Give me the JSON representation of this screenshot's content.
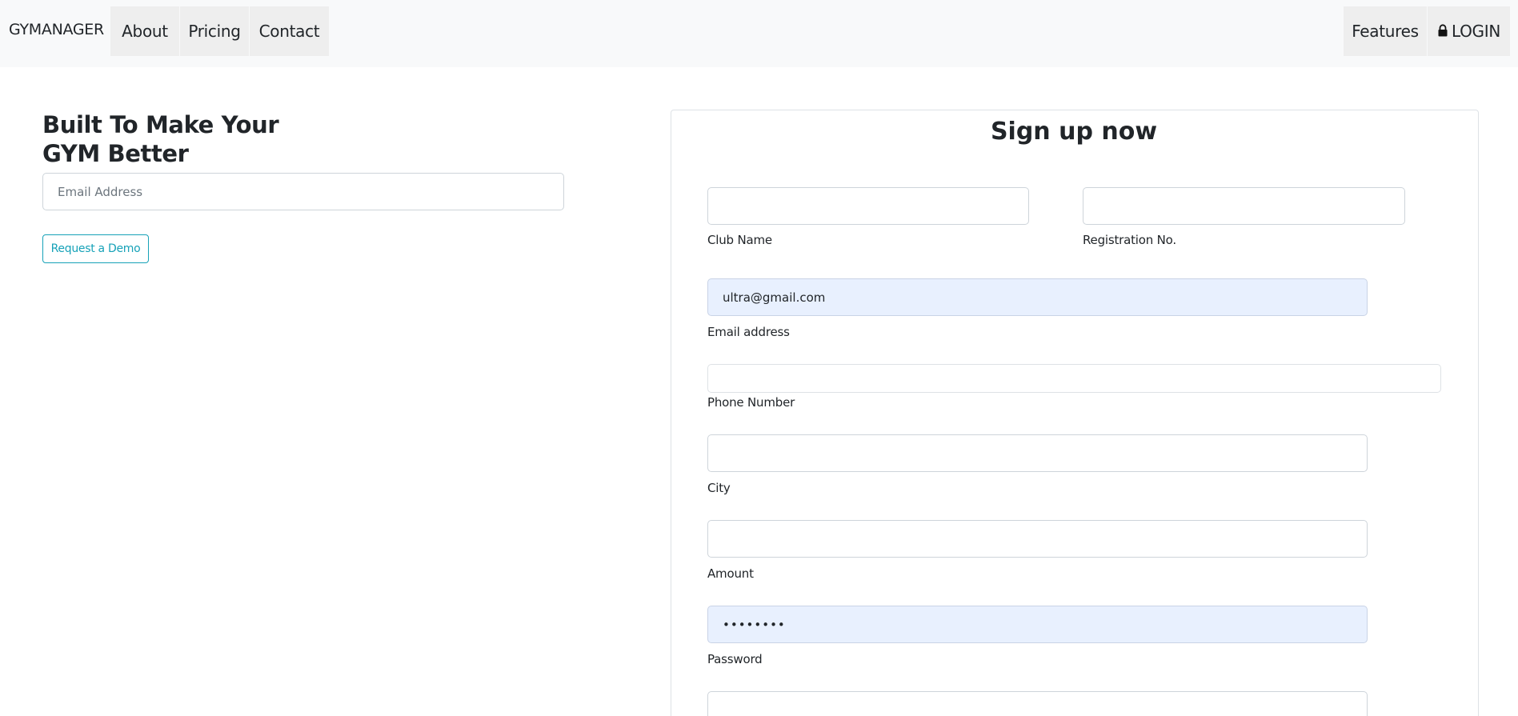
{
  "navbar": {
    "brand": "GYMANAGER",
    "links": [
      {
        "label": "About"
      },
      {
        "label": "Pricing"
      },
      {
        "label": "Contact"
      }
    ],
    "right_links": [
      {
        "label": "Features"
      },
      {
        "label": "LOGIN",
        "icon": "lock-icon"
      }
    ]
  },
  "hero": {
    "title_line1": "Built To Make Your",
    "title_line2": "GYM Better",
    "email_placeholder": "Email Address",
    "demo_button": "Request a Demo"
  },
  "signup": {
    "title": "Sign up now",
    "club_name_label": "Club Name",
    "club_name_value": "",
    "registration_label": "Registration No.",
    "registration_value": "",
    "email_label": "Email address",
    "email_value": "ultra@gmail.com",
    "phone_label": "Phone Number",
    "phone_value": "",
    "city_label": "City",
    "city_value": "",
    "amount_label": "Amount",
    "amount_value": "",
    "password_label": "Password",
    "password_value": "••••••••"
  },
  "colors": {
    "navbar_bg": "#f8f9fa",
    "nav_item_bg": "#eeeeee",
    "accent": "#17a2b8",
    "autofill_bg": "#e8f0fe"
  }
}
